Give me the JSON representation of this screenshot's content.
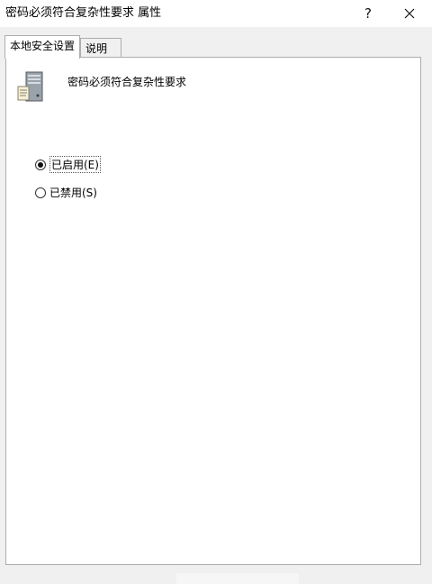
{
  "window": {
    "title": "密码必须符合复杂性要求 属性",
    "help_label": "?"
  },
  "tabs": [
    {
      "label": "本地安全设置",
      "active": true
    },
    {
      "label": "说明",
      "active": false
    }
  ],
  "policy": {
    "name": "密码必须符合复杂性要求",
    "icon": "server-computer-icon"
  },
  "options": [
    {
      "label": "已启用(E)",
      "selected": true
    },
    {
      "label": "已禁用(S)",
      "selected": false
    }
  ]
}
